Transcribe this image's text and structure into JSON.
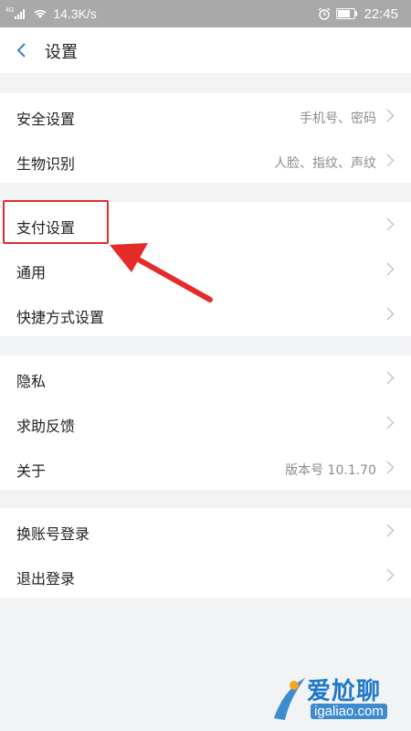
{
  "status_bar": {
    "carrier": "4G",
    "net_speed": "14.3K/s",
    "battery": "70",
    "time": "22:45"
  },
  "header": {
    "title": "设置"
  },
  "sections": [
    {
      "rows": [
        {
          "label": "安全设置",
          "value": "手机号、密码"
        },
        {
          "label": "生物识别",
          "value": "人脸、指纹、声纹"
        }
      ]
    },
    {
      "rows": [
        {
          "label": "支付设置",
          "value": ""
        },
        {
          "label": "通用",
          "value": ""
        },
        {
          "label": "快捷方式设置",
          "value": ""
        }
      ]
    },
    {
      "rows": [
        {
          "label": "隐私",
          "value": ""
        },
        {
          "label": "求助反馈",
          "value": ""
        },
        {
          "label": "关于",
          "value": "版本号 10.1.70"
        }
      ]
    },
    {
      "rows": [
        {
          "label": "换账号登录",
          "value": ""
        },
        {
          "label": "退出登录",
          "value": ""
        }
      ]
    }
  ],
  "annotation": {
    "color": "#e52a2a"
  },
  "watermark": {
    "text": "爱尬聊",
    "url": "igaliao.com"
  }
}
